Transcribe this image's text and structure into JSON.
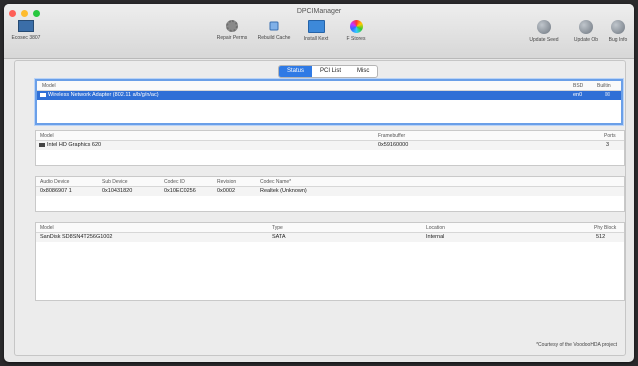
{
  "window": {
    "title": "DPCIManager",
    "lights": [
      "#fe5f57",
      "#febc2e",
      "#28c840"
    ]
  },
  "toolbar": {
    "left_item": "Ecosec 3807",
    "center_items": [
      "Repair Perms",
      "Rebuild Cache",
      "Install Kext",
      "F Stores"
    ],
    "right_items": [
      "Update Seed",
      "Update Ob",
      "Bug Info"
    ]
  },
  "tabs": [
    "Status",
    "PCI List",
    "Misc"
  ],
  "tabs_active": 0,
  "network": {
    "headers": [
      "Model",
      "BSD",
      "Builtin"
    ],
    "rows": [
      {
        "model": "Wireless Network Adapter (802.11 a/b/g/n/ac)",
        "bsd": "en0",
        "builtin": "☒"
      }
    ]
  },
  "graphics": {
    "headers": [
      "Model",
      "Framebuffer",
      "Ports"
    ],
    "rows": [
      {
        "model": "Intel HD Graphics 620",
        "framebuffer": "0x59160000",
        "ports": "3"
      }
    ]
  },
  "audio": {
    "headers": [
      "Audio Device",
      "Sub Device",
      "Codec ID",
      "Revision",
      "Codec Name*"
    ],
    "rows": [
      {
        "device": "0x8086907 1",
        "sub": "0x10431820",
        "codec": "0x10EC0256",
        "rev": "0x0002",
        "name": "Realtek (Unknown)"
      }
    ]
  },
  "storage": {
    "headers": [
      "Model",
      "Type",
      "Location",
      "Phy Block"
    ],
    "rows": [
      {
        "model": "SanDisk SD8SN4T256G1002",
        "type": "SATA",
        "location": "Internal",
        "block": "512"
      }
    ]
  },
  "footer": "*Courtesy of the VoodooHDA project"
}
